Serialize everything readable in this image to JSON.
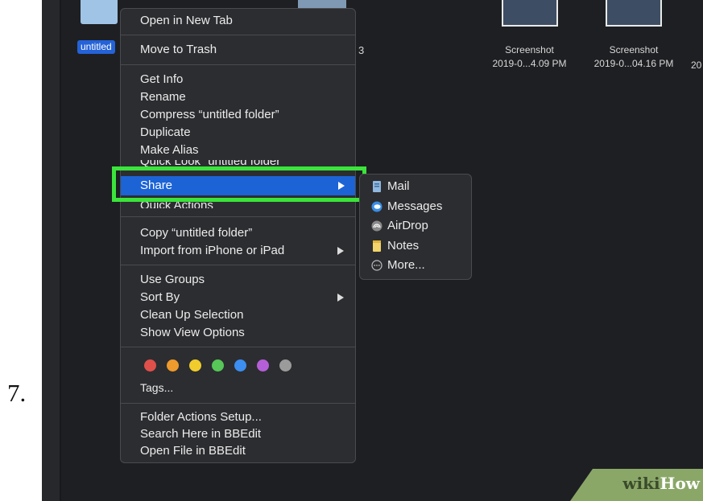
{
  "step_number": "7.",
  "desktop": {
    "selected_label": "untitled",
    "partial_item": "3",
    "screenshots": [
      {
        "name": "Screenshot",
        "date": "2019-0...4.09 PM"
      },
      {
        "name": "Screenshot",
        "date": "2019-0...04.16 PM"
      }
    ],
    "cut_text": "20"
  },
  "context_menu": {
    "open_new_tab": "Open in New Tab",
    "move_to_trash": "Move to Trash",
    "get_info": "Get Info",
    "rename": "Rename",
    "compress": "Compress “untitled folder”",
    "duplicate": "Duplicate",
    "make_alias": "Make Alias",
    "quick_look": "Quick Look “untitled folder”",
    "share": "Share",
    "quick_actions": "Quick Actions",
    "copy": "Copy “untitled folder”",
    "import": "Import from iPhone or iPad",
    "use_groups": "Use Groups",
    "sort_by": "Sort By",
    "clean_up": "Clean Up Selection",
    "view_options": "Show View Options",
    "tags_label": "Tags...",
    "folder_actions": "Folder Actions Setup...",
    "search_bbedit": "Search Here in BBEdit",
    "open_bbedit": "Open File in BBEdit",
    "tag_colors": [
      "#e0504a",
      "#ee9a2c",
      "#f0cd2c",
      "#56c758",
      "#3c8ef0",
      "#b45fd8",
      "#9b9b9b"
    ]
  },
  "share_submenu": {
    "items": [
      {
        "label": "Mail",
        "icon": "mail-icon"
      },
      {
        "label": "Messages",
        "icon": "messages-icon"
      },
      {
        "label": "AirDrop",
        "icon": "airdrop-icon"
      },
      {
        "label": "Notes",
        "icon": "notes-icon"
      },
      {
        "label": "More...",
        "icon": "more-icon"
      }
    ]
  },
  "watermark": {
    "wiki": "wiki",
    "how": "How"
  },
  "colors": {
    "highlight": "#3be43b",
    "selection": "#1c63d6",
    "menu_bg": "#2c2d30"
  }
}
